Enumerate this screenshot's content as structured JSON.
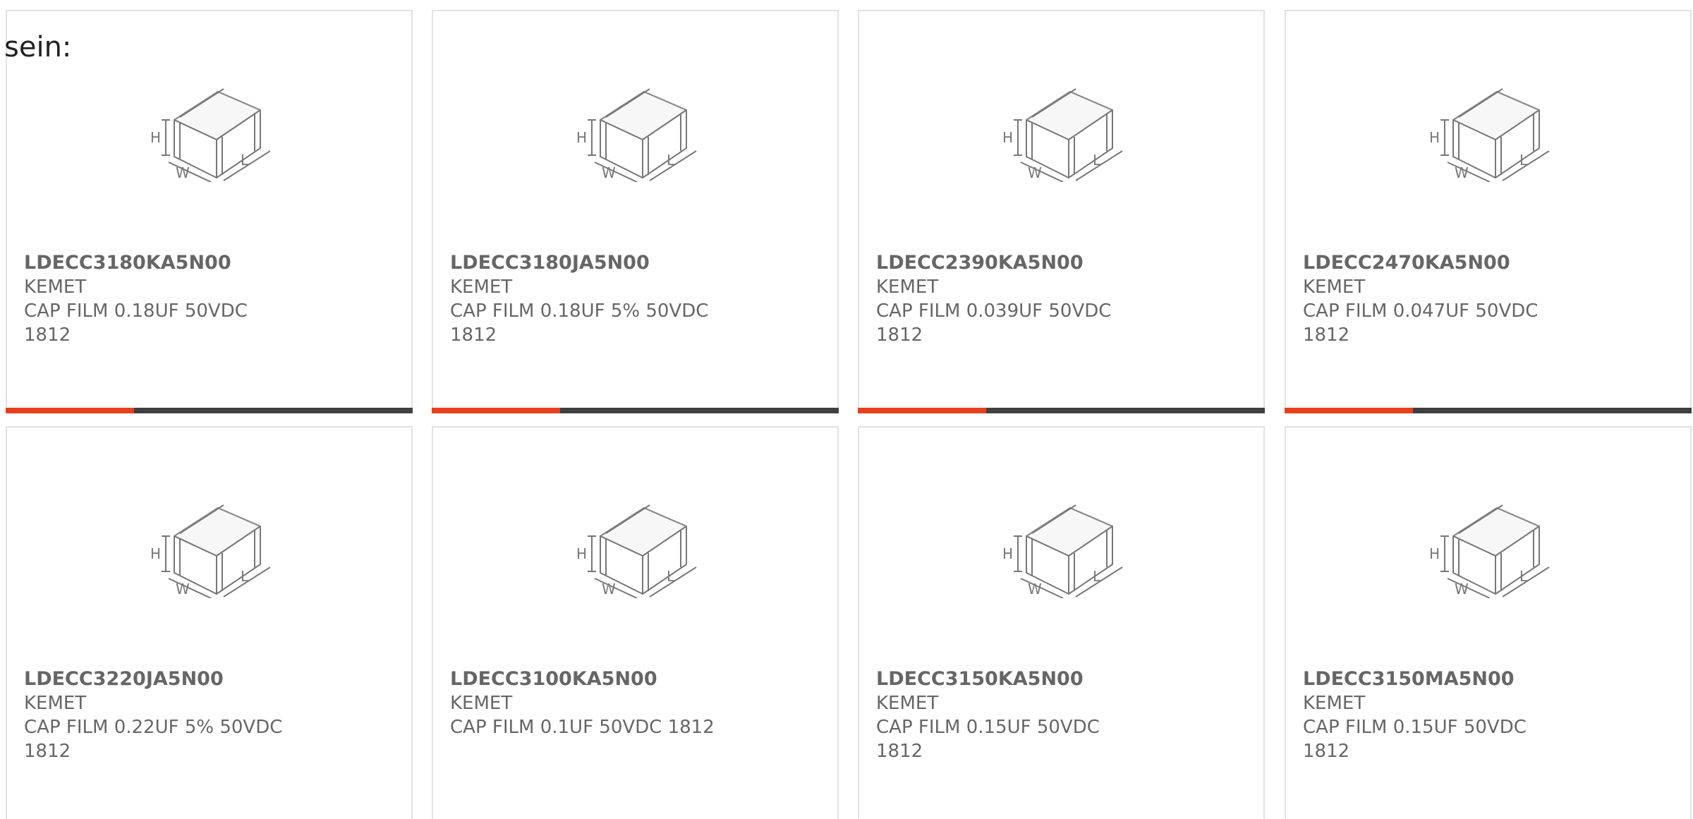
{
  "intro_text": "sein:",
  "colors": {
    "accent": "#e8401c",
    "bar": "#404040",
    "card_border": "#e2e2e2",
    "text": "#666666"
  },
  "products": [
    {
      "part": "LDECC3180KA5N00",
      "manufacturer": "KEMET",
      "description": "CAP FILM 0.18UF 50VDC 1812",
      "image": "smd-component-dimension-icon"
    },
    {
      "part": "LDECC3180JA5N00",
      "manufacturer": "KEMET",
      "description": "CAP FILM 0.18UF 5% 50VDC 1812",
      "image": "smd-component-dimension-icon"
    },
    {
      "part": "LDECC2390KA5N00",
      "manufacturer": "KEMET",
      "description": "CAP FILM 0.039UF 50VDC 1812",
      "image": "smd-component-dimension-icon"
    },
    {
      "part": "LDECC2470KA5N00",
      "manufacturer": "KEMET",
      "description": "CAP FILM 0.047UF 50VDC 1812",
      "image": "smd-component-dimension-icon"
    },
    {
      "part": "LDECC3220JA5N00",
      "manufacturer": "KEMET",
      "description": "CAP FILM 0.22UF 5% 50VDC 1812",
      "image": "smd-component-dimension-icon"
    },
    {
      "part": "LDECC3100KA5N00",
      "manufacturer": "KEMET",
      "description": "CAP FILM 0.1UF 50VDC 1812",
      "image": "smd-component-dimension-icon"
    },
    {
      "part": "LDECC3150KA5N00",
      "manufacturer": "KEMET",
      "description": "CAP FILM 0.15UF 50VDC 1812",
      "image": "smd-component-dimension-icon"
    },
    {
      "part": "LDECC3150MA5N00",
      "manufacturer": "KEMET",
      "description": "CAP FILM 0.15UF 50VDC 1812",
      "image": "smd-component-dimension-icon"
    }
  ],
  "diagram_labels": {
    "height": "H",
    "width": "W",
    "length": "L"
  }
}
